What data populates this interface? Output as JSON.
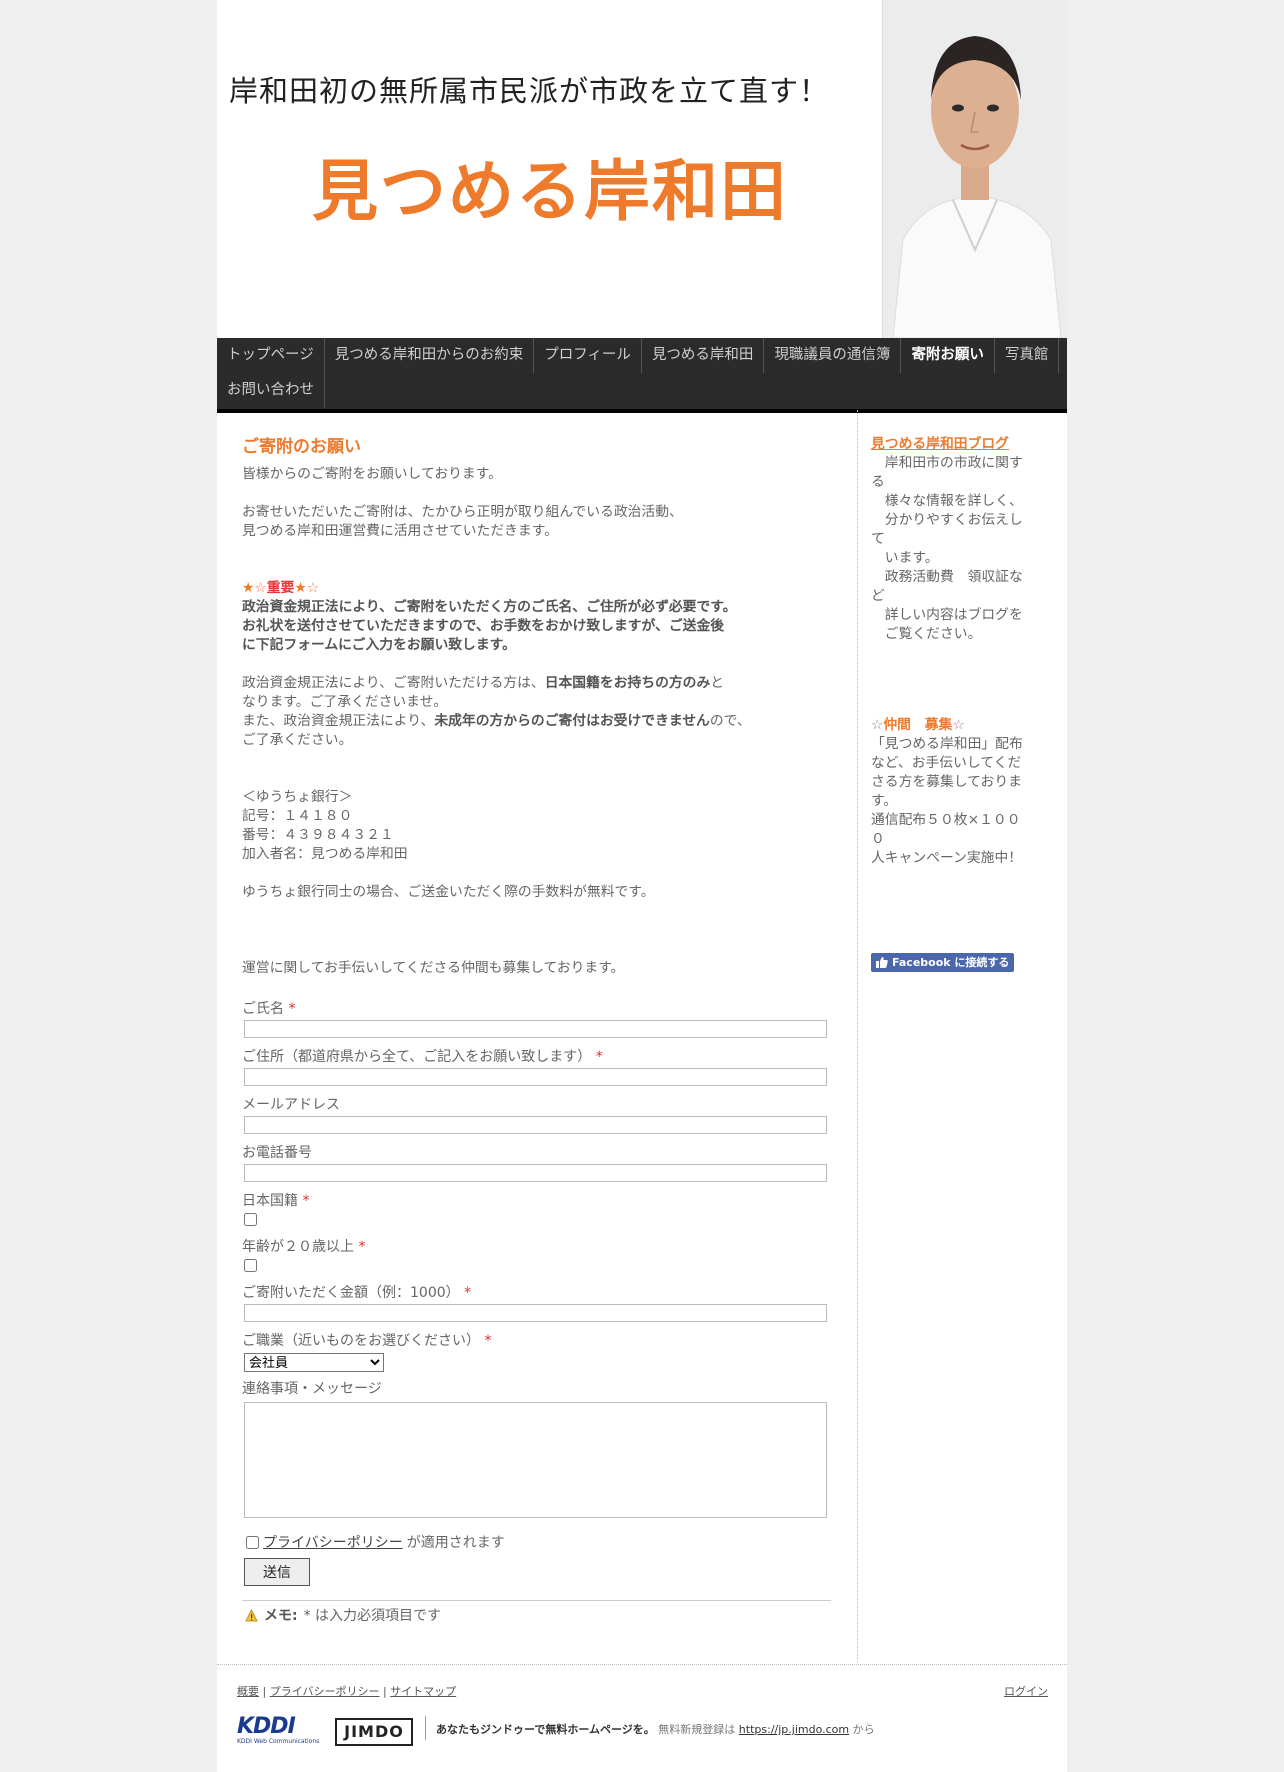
{
  "header": {
    "tagline": "岸和田初の無所属市民派が市政を立て直す！",
    "brand": "見つめる岸和田"
  },
  "nav": {
    "row1": [
      "トップページ",
      "見つめる岸和田からのお約束",
      "プロフィール",
      "見つめる岸和田",
      "現職議員の通信簿",
      "寄附お願い",
      "写真館"
    ],
    "row2": [
      "お問い合わせ"
    ],
    "active": "寄附お願い"
  },
  "main": {
    "title": "ご寄附のお願い",
    "intro": "皆様からのご寄附をお願いしております。",
    "usage1": "お寄せいただいたご寄附は、たかひら正明が取り組んでいる政治活動、",
    "usage2": "見つめる岸和田運営費に活用させていただきます。",
    "important_prefix": "★☆",
    "important_word": "重要",
    "important_suffix": "★☆",
    "imp1": "政治資金規正法により、ご寄附をいただく方のご氏名、ご住所が必ず必要です。",
    "imp2": "お礼状を送付させていただきますので、お手数をおかけ致しますが、ご送金後",
    "imp3": "に下記フォームにご入力をお願い致します。",
    "law1a": "政治資金規正法により、ご寄附いただける方は、",
    "law1b": "日本国籍をお持ちの方のみ",
    "law1c": "と",
    "law2": "なります。ご了承くださいませ。",
    "law3a": "また、政治資金規正法により、",
    "law3b": "未成年の方からのご寄付はお受けできません",
    "law3c": "ので、",
    "law4": "ご了承ください。",
    "bank_name": "＜ゆうちょ銀行＞",
    "bank_code": "記号：１４１８０",
    "bank_number": "番号：４３９８４３２１",
    "bank_holder": "加入者名：見つめる岸和田",
    "fee_note": "ゆうちょ銀行同士の場合、ご送金いただく際の手数料が無料です。",
    "recruit_note": "運営に関してお手伝いしてくださる仲間も募集しております。"
  },
  "form": {
    "name_label": "ご氏名",
    "address_label": "ご住所（都道府県から全て、ご記入をお願い致します）",
    "email_label": "メールアドレス",
    "phone_label": "お電話番号",
    "nationality_label": "日本国籍",
    "age_label": "年齢が２０歳以上",
    "amount_label": "ご寄附いただく金額（例：1000）",
    "job_label": "ご職業（近いものをお選びください）",
    "job_selected": "会社員",
    "message_label": "連絡事項・メッセージ",
    "required_mark": "*",
    "privacy_link": "プライバシーポリシー",
    "privacy_suffix": "が適用されます",
    "submit": "送信",
    "memo_label": "メモ:",
    "memo_text": "* は入力必須項目です"
  },
  "sidebar": {
    "blog_link": "見つめる岸和田ブログ",
    "blog_lines": [
      "　岸和田市の市政に関す",
      "る",
      "　様々な情報を詳しく、",
      "　分かりやすくお伝えし",
      "て",
      "　います。",
      "　政務活動費　領収証な",
      "ど",
      "　詳しい内容はブログを",
      "　ご覧ください。"
    ],
    "recruit_star1": "☆",
    "recruit_title": "仲間　募集",
    "recruit_star2": "☆",
    "recruit_lines": [
      "「見つめる岸和田」配布",
      "など、お手伝いしてくだ",
      "さる方を募集しておりま",
      "す。",
      "通信配布５０枚×１０００",
      "人キャンペーン実施中！"
    ],
    "facebook_button": "Facebook に接続する"
  },
  "footer": {
    "about": "概要",
    "privacy": "プライバシーポリシー",
    "sitemap": "サイトマップ",
    "login": "ログイン",
    "kddi": "KDDI",
    "kddi_sub": "KDDI Web Communications",
    "jimdo": "JIMDO",
    "promo": "あなたもジンドゥーで無料ホームページを。",
    "signup": "無料新規登録は",
    "url": "https://jp.jimdo.com",
    "from": "から"
  },
  "colors": {
    "accent": "#ee7a2c",
    "nav_bg": "#2b2b2b",
    "facebook": "#4a67ad"
  }
}
